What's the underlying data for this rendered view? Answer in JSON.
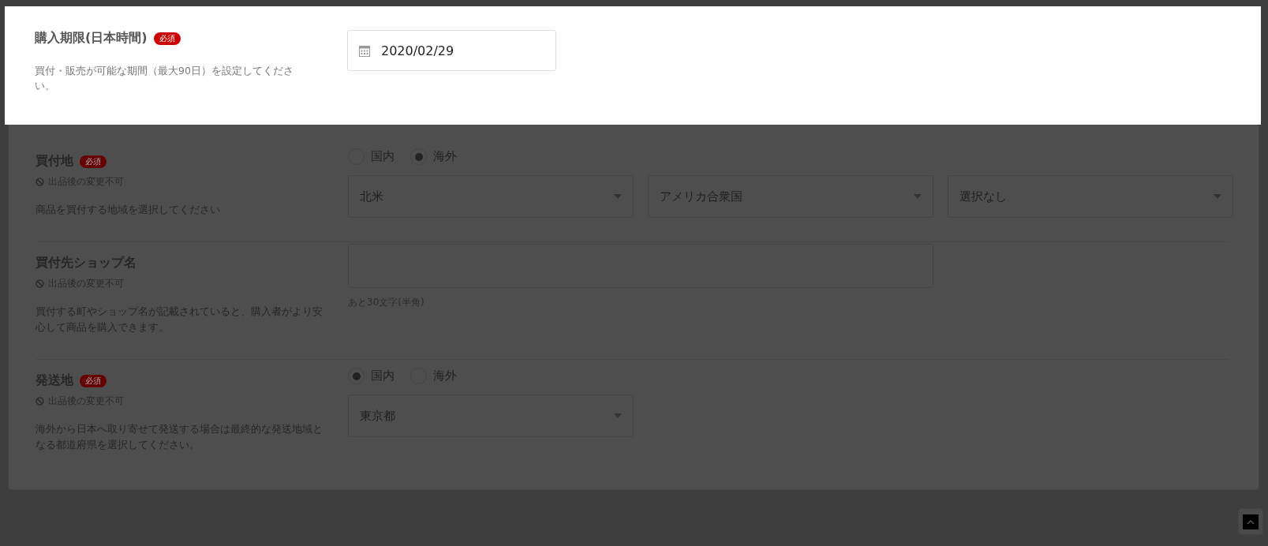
{
  "highlighted_field": {
    "label": "購入期限(日本時間)",
    "required_badge": "必須",
    "description": "買付・販売が可能な期間（最大90日）を設定してください。",
    "date_value": "2020/02/29"
  },
  "fields": [
    {
      "kind": "region",
      "label": "買付地",
      "required_badge": "必須",
      "lock_note": "出品後の変更不可",
      "description": "商品を買付する地域を選択してください",
      "radios": [
        {
          "label": "国内",
          "selected": false
        },
        {
          "label": "海外",
          "selected": true
        }
      ],
      "selects": [
        "北米",
        "アメリカ合衆国",
        "選択なし"
      ]
    },
    {
      "kind": "text",
      "label": "買付先ショップ名",
      "lock_note": "出品後の変更不可",
      "description": "買付する町やショップ名が記載されていると、購入者がより安心して商品を購入できます。",
      "hint": "あと30文字(半角)"
    },
    {
      "kind": "region",
      "label": "発送地",
      "required_badge": "必須",
      "lock_note": "出品後の変更不可",
      "description": "海外から日本へ取り寄せて発送する場合は最終的な発送地域となる都道府県を選択してください。",
      "radios": [
        {
          "label": "国内",
          "selected": true
        },
        {
          "label": "海外",
          "selected": false
        }
      ],
      "selects": [
        "東京都"
      ]
    }
  ]
}
